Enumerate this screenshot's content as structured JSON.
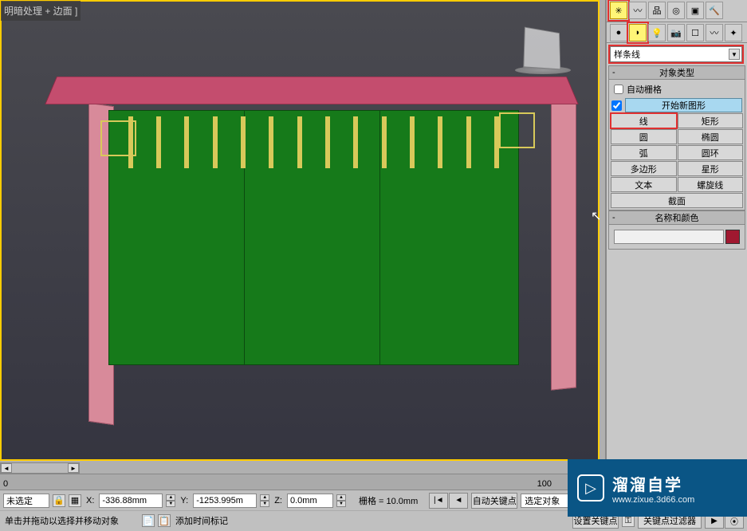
{
  "viewport": {
    "label": "明暗处理 + 边面 ]"
  },
  "create_panel": {
    "category": "样条线",
    "object_type_header": "对象类型",
    "auto_grid": "自动栅格",
    "start_new_shape": "开始新图形",
    "start_new_shape_checked": true,
    "buttons": {
      "line": "线",
      "rectangle": "矩形",
      "circle": "圆",
      "ellipse": "椭圆",
      "arc": "弧",
      "donut": "圆环",
      "ngon": "多边形",
      "star": "星形",
      "text": "文本",
      "helix": "螺旋线",
      "section": "截面"
    },
    "name_and_color": "名称和颜色"
  },
  "status": {
    "selection": "未选定",
    "x_label": "X:",
    "x_val": "-336.88mm",
    "y_label": "Y:",
    "y_val": "-1253.995m",
    "z_label": "Z:",
    "z_val": "0.0mm",
    "grid": "栅格 = 10.0mm",
    "prompt": "单击并拖动以选择并移动对象",
    "add_time_tag": "添加时间标记",
    "auto_key": "自动关键点",
    "set_key": "设置关键点",
    "selected_obj": "选定对象",
    "key_filter": "关键点过滤器"
  },
  "timeline": {
    "start": "0",
    "end": "100"
  },
  "watermark": {
    "title": "溜溜自学",
    "url": "www.zixue.3d66.com"
  },
  "icons": {
    "create": "✳",
    "modify": "〰",
    "hierarchy": "品",
    "motion": "◎",
    "display": "▣",
    "utilities": "🔨",
    "geom": "●",
    "shapes": "◗",
    "lights": "💡",
    "cameras": "📷",
    "helpers": "☐",
    "space": "〰",
    "systems": "✦"
  }
}
